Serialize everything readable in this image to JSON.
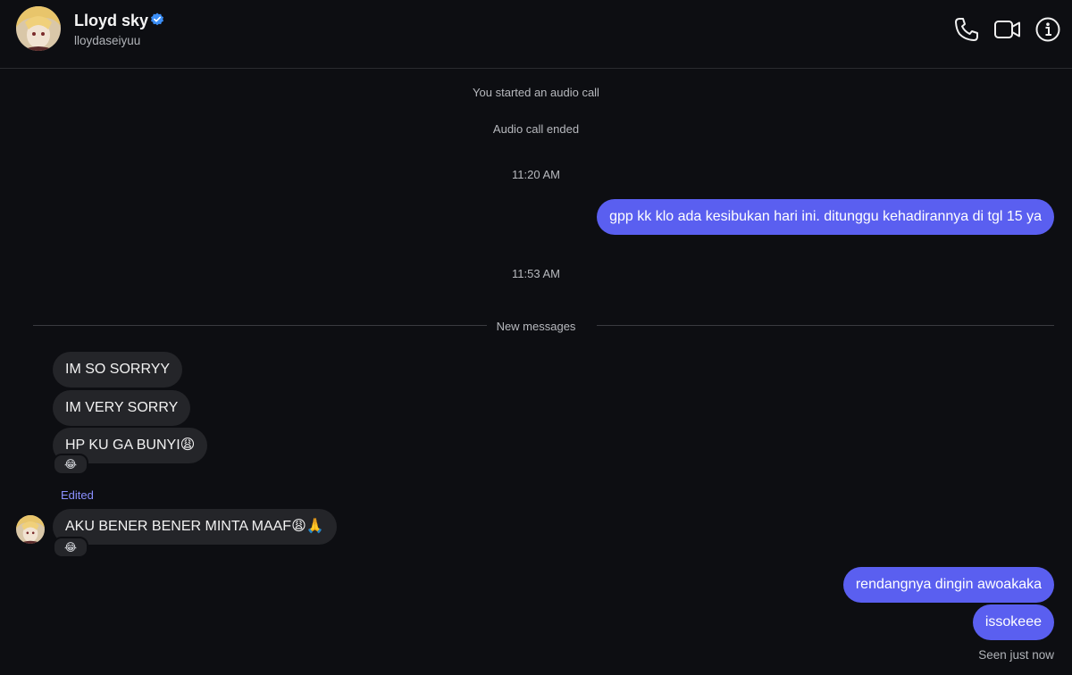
{
  "header": {
    "name": "Lloyd sky",
    "handle": "lloydaseiyuu",
    "icons": [
      "avatar",
      "verified-badge-icon",
      "phone-icon",
      "video-camera-icon",
      "info-icon"
    ]
  },
  "conversation": {
    "system_events": [
      "You started an audio call",
      "Audio call ended"
    ],
    "timestamps": [
      "11:20 AM",
      "11:53 AM"
    ],
    "new_messages_label": "New messages",
    "edited_label": "Edited",
    "seen_label": "Seen just now",
    "messages": [
      {
        "from": "me",
        "text": "gpp kk klo ada kesibukan hari ini. ditunggu kehadirannya di tgl 15 ya"
      },
      {
        "from": "them",
        "text": "IM SO SORRYY"
      },
      {
        "from": "them",
        "text": "IM VERY SORRY"
      },
      {
        "from": "them",
        "text": "HP KU GA BUNYI😩",
        "reaction": "😂"
      },
      {
        "from": "them",
        "text": "AKU BENER BENER MINTA MAAF😩🙏",
        "reaction": "😂"
      },
      {
        "from": "me",
        "text": "rendangnya dingin awoakaka"
      },
      {
        "from": "me",
        "text": "issokeee"
      }
    ]
  },
  "colors": {
    "background": "#0d0e12",
    "outgoing_bubble": "#5a5ff0",
    "incoming_bubble": "#242529",
    "edited_text": "#8b90ff",
    "verified_badge": "#3b8ef6"
  }
}
